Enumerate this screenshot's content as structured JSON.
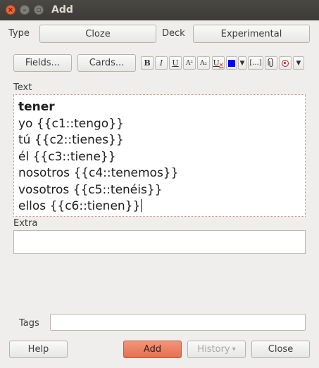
{
  "window": {
    "title": "Add"
  },
  "type_row": {
    "type_label": "Type",
    "type_value": "Cloze",
    "deck_label": "Deck",
    "deck_value": "Experimental"
  },
  "toolbar": {
    "fields_label": "Fields...",
    "cards_label": "Cards...",
    "bold": "B",
    "italic": "I",
    "underline": "U",
    "superscript": "A²",
    "subscript": "A₂",
    "clear_format": "U",
    "cloze": "[...]",
    "text_color": "#0000ff",
    "arrow": "▼"
  },
  "text_field": {
    "label": "Text",
    "lines": [
      "tener",
      "yo {{c1::tengo}}",
      "tú {{c2::tienes}}",
      "él {{c3::tiene}}",
      "nosotros {{c4::tenemos}}",
      "vosotros {{c5::tenéis}}",
      "ellos {{c6::tienen}}"
    ]
  },
  "extra_field": {
    "label": "Extra",
    "value": ""
  },
  "tags": {
    "label": "Tags",
    "value": ""
  },
  "buttons": {
    "help": "Help",
    "add": "Add",
    "history": "History",
    "history_arrow": "▾",
    "close": "Close"
  },
  "colors": {
    "accent": "#e5704f",
    "titlebar": "#3c3b37",
    "focus_border": "#d08a70"
  }
}
